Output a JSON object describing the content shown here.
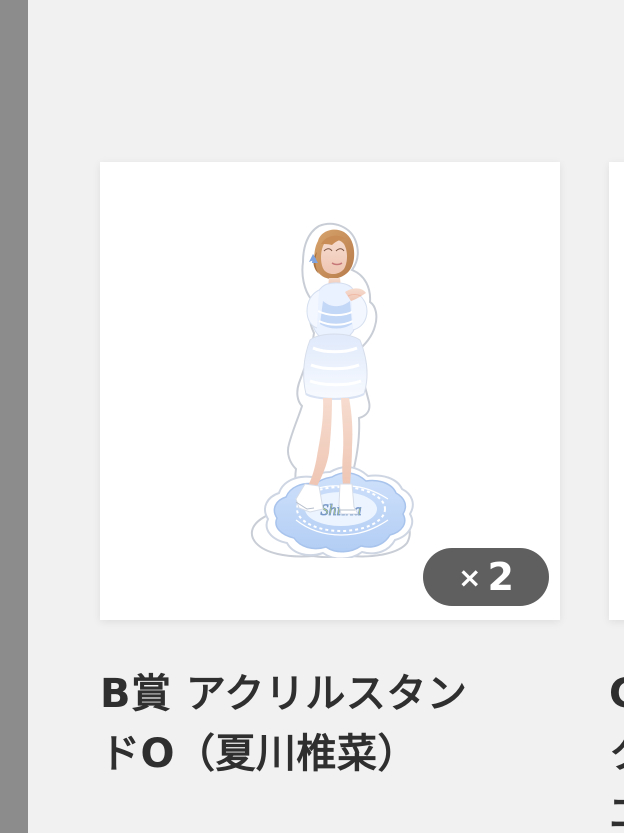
{
  "current_item": {
    "image_caption": "Shiina",
    "quantity_prefix": "×",
    "quantity_value": "2",
    "title_line_1": "B賞 アクリルスタン",
    "title_line_2": "ドO（夏川椎菜）"
  },
  "next_item": {
    "title_line_1": "C",
    "title_line_2": "ク",
    "title_line_3": "エ"
  }
}
